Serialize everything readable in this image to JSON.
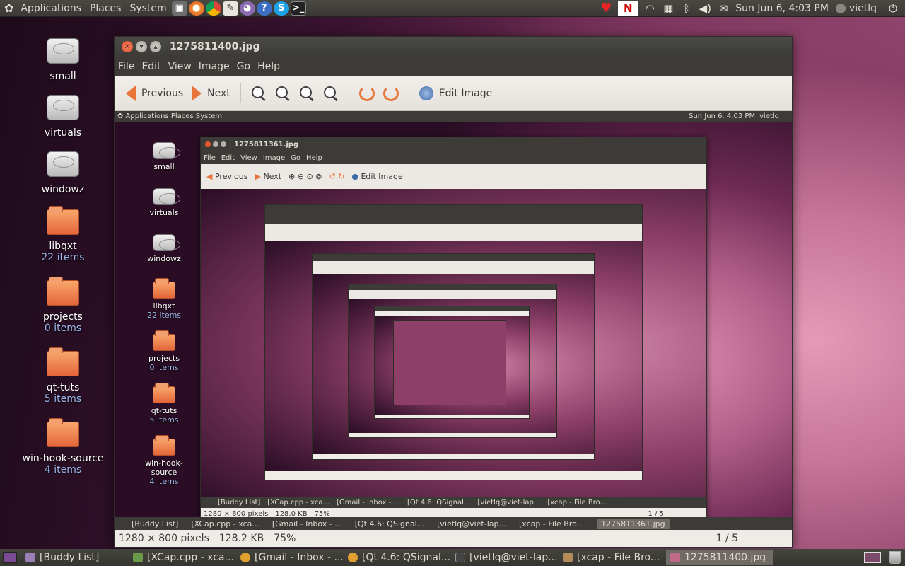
{
  "top_panel": {
    "menus": [
      "Applications",
      "Places",
      "System"
    ],
    "clock": "Sun Jun  6,  4:03 PM",
    "user": "vietlq"
  },
  "desktop": {
    "items": [
      {
        "name": "small",
        "type": "drive",
        "sub": ""
      },
      {
        "name": "virtuals",
        "type": "drive",
        "sub": ""
      },
      {
        "name": "windowz",
        "type": "drive",
        "sub": ""
      },
      {
        "name": "libqxt",
        "type": "folder",
        "sub": "22 items"
      },
      {
        "name": "projects",
        "type": "folder",
        "sub": "0 items"
      },
      {
        "name": "qt-tuts",
        "type": "folder",
        "sub": "5 items"
      },
      {
        "name": "win-hook-source",
        "type": "folder",
        "sub": "4 items"
      }
    ]
  },
  "window": {
    "title": "1275811400.jpg",
    "menu": [
      "File",
      "Edit",
      "View",
      "Image",
      "Go",
      "Help"
    ],
    "toolbar": {
      "previous": "Previous",
      "next": "Next",
      "edit_image": "Edit Image"
    },
    "status": {
      "dimensions": "1280 × 800 pixels",
      "size": "128.2 KB",
      "zoom": "75%",
      "position": "1 / 5"
    }
  },
  "nested": {
    "clock": "Sun Jun  6,  4:03 PM",
    "user": "vietlq",
    "title": "1275811361.jpg",
    "status": {
      "dimensions": "1280 × 800 pixels",
      "size": "128.0 KB",
      "zoom": "75%",
      "position": "1 / 5"
    },
    "tasks": [
      "[Buddy List]",
      "[XCap.cpp - xca...",
      "[Gmail - Inbox - ...",
      "[Qt 4.6: QSignal...",
      "[vietlq@viet-lap...",
      "[xcap - File Bro...",
      "1275811361.jpg"
    ]
  },
  "bottom_panel": {
    "tasks": [
      {
        "label": "[Buddy List]",
        "color": "#9a7fb5"
      },
      {
        "label": "[XCap.cpp - xca...",
        "color": "#6a9a4a"
      },
      {
        "label": "[Gmail - Inbox - ...",
        "color": "#e0a030"
      },
      {
        "label": "[Qt 4.6: QSignal...",
        "color": "#e0a030"
      },
      {
        "label": "[vietlq@viet-lap...",
        "color": "#444444"
      },
      {
        "label": "[xcap - File Bro...",
        "color": "#b48a5a"
      },
      {
        "label": "1275811400.jpg",
        "color": "#c06a8a"
      }
    ]
  }
}
